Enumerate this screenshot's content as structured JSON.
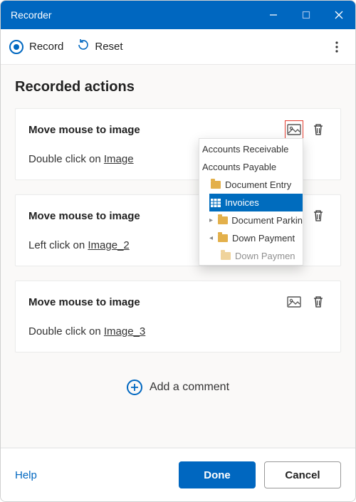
{
  "window": {
    "title": "Recorder"
  },
  "toolbar": {
    "record_label": "Record",
    "reset_label": "Reset"
  },
  "heading": "Recorded actions",
  "actions": [
    {
      "title": "Move mouse to image",
      "desc_prefix": "Double click on ",
      "target": "Image",
      "thumb_highlight": true
    },
    {
      "title": "Move mouse to image",
      "desc_prefix": "Left click on ",
      "target": "Image_2",
      "thumb_highlight": false
    },
    {
      "title": "Move mouse to image",
      "desc_prefix": "Double click on ",
      "target": "Image_3",
      "thumb_highlight": false
    }
  ],
  "add_comment_label": "Add a comment",
  "footer": {
    "help": "Help",
    "done": "Done",
    "cancel": "Cancel"
  },
  "tree": {
    "items": [
      {
        "label": "Accounts Receivable"
      },
      {
        "label": "Accounts Payable"
      },
      {
        "label": "Document Entry"
      },
      {
        "label": "Invoices"
      },
      {
        "label": "Document Parkin"
      },
      {
        "label": "Down Payment"
      },
      {
        "label": "Down Paymen"
      }
    ]
  }
}
